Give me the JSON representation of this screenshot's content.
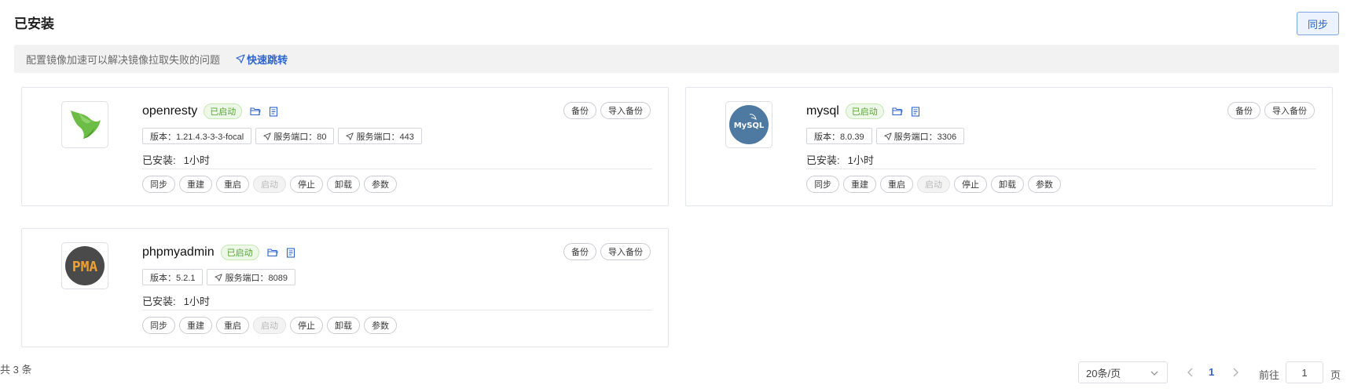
{
  "header": {
    "title": "已安装",
    "sync_label": "同步"
  },
  "notice": {
    "text": "配置镜像加速可以解决镜像拉取失败的问题",
    "link": "快速跳转"
  },
  "labels": {
    "backup": "备份",
    "import_backup": "导入备份",
    "installed_prefix": "已安装:",
    "actions": [
      "同步",
      "重建",
      "重启",
      "启动",
      "停止",
      "卸载",
      "参数"
    ]
  },
  "apps": [
    {
      "name": "openresty",
      "status": "已启动",
      "logo": "openresty-logo",
      "tags": [
        "版本：1.21.4.3-3-3-focal",
        "服务端口：80",
        "服务端口：443"
      ],
      "installed_time": "1小时"
    },
    {
      "name": "mysql",
      "status": "已启动",
      "logo": "mysql-logo",
      "tags": [
        "版本：8.0.39",
        "服务端口：3306"
      ],
      "installed_time": "1小时"
    },
    {
      "name": "phpmyadmin",
      "status": "已启动",
      "logo": "phpmyadmin-logo",
      "tags": [
        "版本：5.2.1",
        "服务端口：8089"
      ],
      "installed_time": "1小时"
    }
  ],
  "logo_text": {
    "mysql": "MySQL",
    "pma": "PMA"
  },
  "pagination": {
    "total": "共 3 条",
    "page_size": "20条/页",
    "current_page": "1",
    "goto_label": "前往",
    "goto_value": "1",
    "page_suffix": "页"
  },
  "colors": {
    "accent": "#2d64cf",
    "status_green": "#55a532",
    "border": "#e4e7ed"
  }
}
